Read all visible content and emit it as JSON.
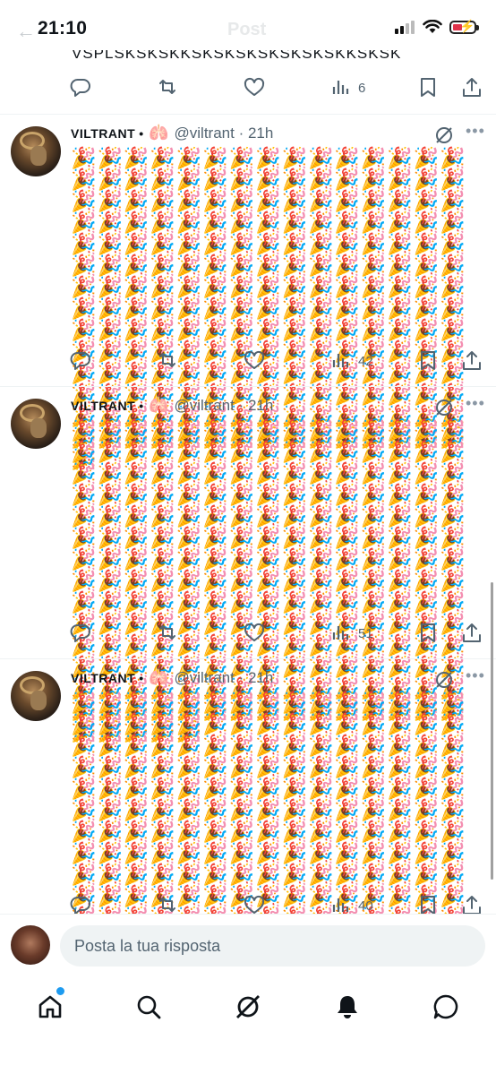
{
  "status_bar": {
    "time": "21:10",
    "ghost_title": "Post",
    "ghost_back": "←"
  },
  "cut_off_post": {
    "text_fragment": "VSPLSKSKSKKSKSKSKSKSKSKSKKSKSK",
    "views": "6"
  },
  "tweets": [
    {
      "name": "VILTRANT",
      "bullet": "•",
      "badge": "🫁",
      "handle": "@viltrant · 21h",
      "more": "•••",
      "emoji": "🎉",
      "emoji_count": 211,
      "views": "42"
    },
    {
      "name": "VILTRANT",
      "bullet": "•",
      "badge": "🫁",
      "handle": "@viltrant · 21h",
      "more": "•••",
      "emoji": "🎉",
      "emoji_count": 215,
      "views": "51"
    },
    {
      "name": "VILTRANT",
      "bullet": "•",
      "badge": "🫁",
      "handle": "@viltrant · 21h",
      "more": "•••",
      "emoji": "🎉",
      "emoji_count": 205,
      "views": "40"
    }
  ],
  "reply": {
    "placeholder": "Posta la tua risposta"
  },
  "tab_bar": {
    "items": [
      "home-icon",
      "search-icon",
      "grok-icon",
      "notifications-icon",
      "messages-icon"
    ],
    "home_badge_color": "#1d9bf0"
  },
  "colors": {
    "text": "#0f1419",
    "muted": "#536471",
    "accent": "#1d9bf0",
    "battery_low": "#e0334a"
  }
}
